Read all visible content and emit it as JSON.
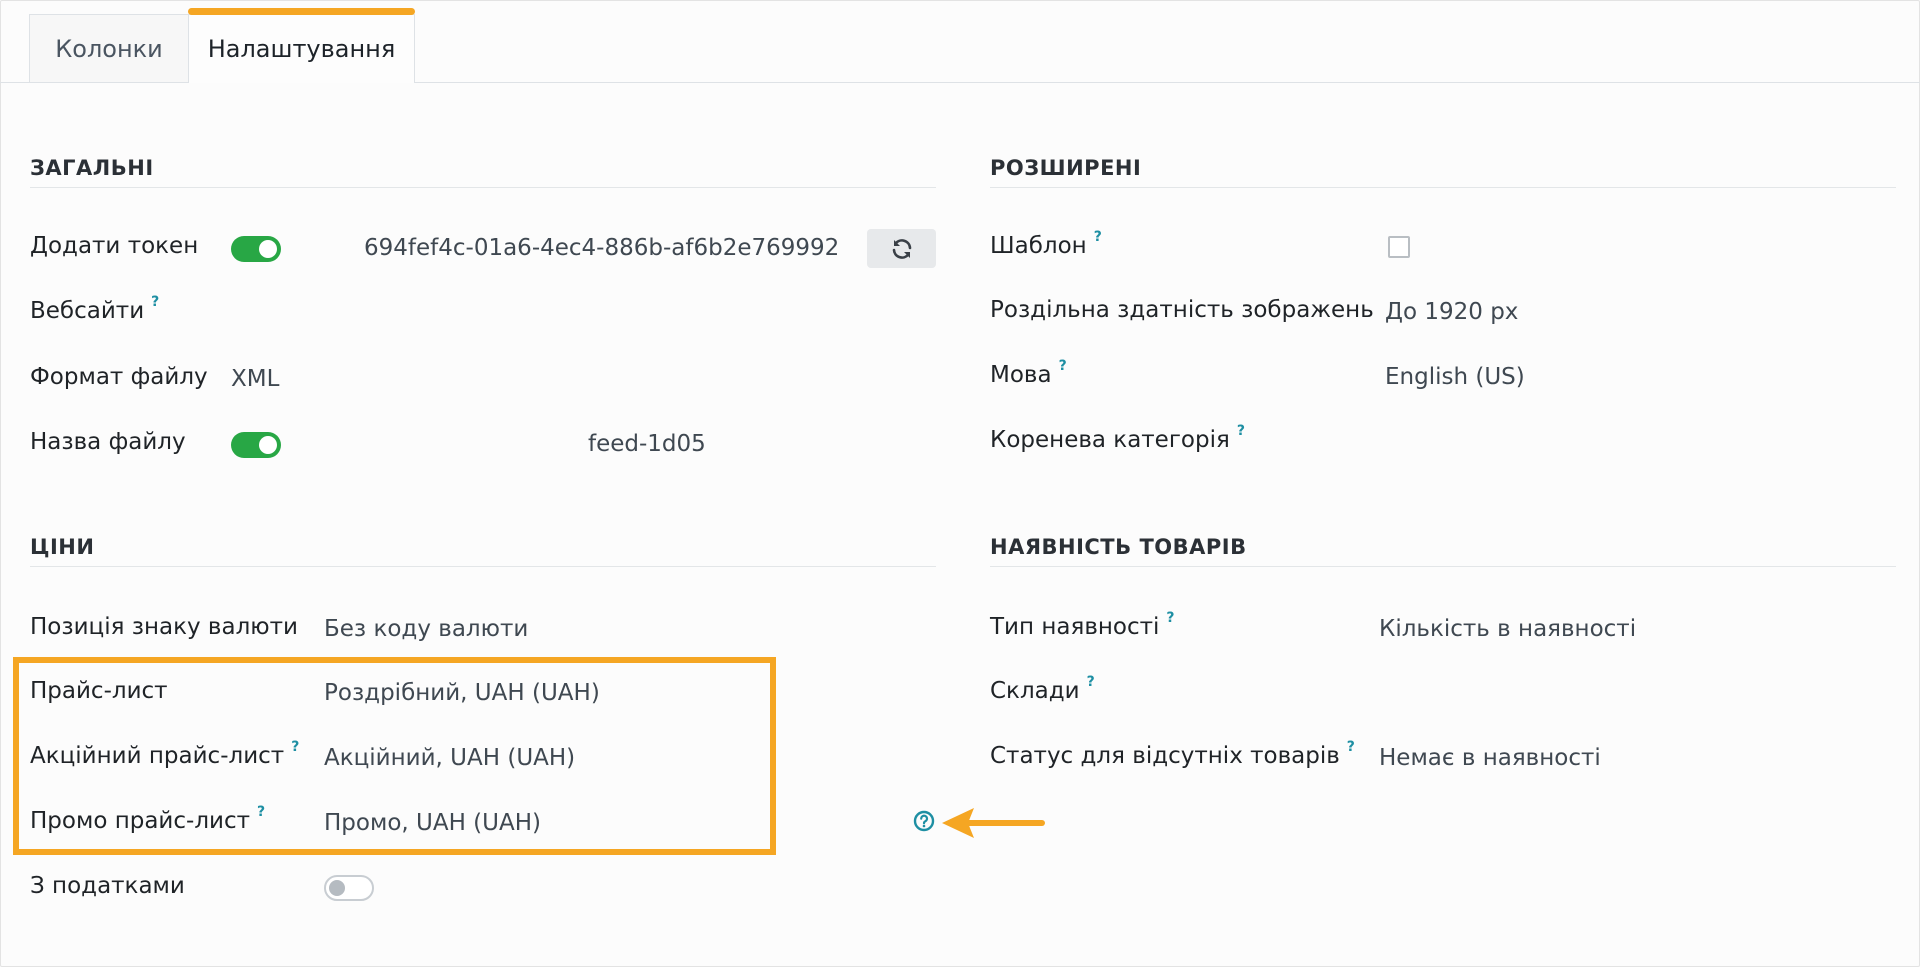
{
  "tabs": [
    {
      "label": "Колонки",
      "active": false
    },
    {
      "label": "Налаштування",
      "active": true
    }
  ],
  "general": {
    "title": "ЗАГАЛЬНІ",
    "add_token_label": "Додати токен",
    "add_token_enabled": true,
    "token_value": "694fef4c-01a6-4ec4-886b-af6b2e769992",
    "websites_label": "Вебсайти",
    "file_format_label": "Формат файлу",
    "file_format_value": "XML",
    "file_name_label": "Назва файлу",
    "file_name_enabled": true,
    "file_name_value": "feed-1d05"
  },
  "prices": {
    "title": "ЦІНИ",
    "currency_position_label": "Позиція знаку валюти",
    "currency_position_value": "Без коду валюти",
    "pricelist_label": "Прайс-лист",
    "pricelist_value": "Роздрібний, UAH (UAH)",
    "sale_pricelist_label": "Акційний прайс-лист",
    "sale_pricelist_value": "Акційний, UAH (UAH)",
    "promo_pricelist_label": "Промо прайс-лист",
    "promo_pricelist_value": "Промо, UAH (UAH)",
    "with_taxes_label": "З податками",
    "with_taxes_enabled": false
  },
  "advanced": {
    "title": "РОЗШИРЕНІ",
    "template_label": "Шаблон",
    "template_checked": false,
    "image_resolution_label": "Роздільна здатність зображень",
    "image_resolution_value": "До 1920 px",
    "language_label": "Мова",
    "language_value": "English (US)",
    "root_category_label": "Коренева категорія"
  },
  "availability": {
    "title": "НАЯВНІСТЬ ТОВАРІВ",
    "type_label": "Тип наявності",
    "type_value": "Кількість в наявності",
    "warehouses_label": "Склади",
    "missing_status_label": "Статус для відсутніх товарів",
    "missing_status_value": "Немає в наявності"
  },
  "help_mark": "?",
  "colors": {
    "accent": "#f5a623",
    "toggle_on": "#28a745",
    "help": "#1e8fa3"
  },
  "icons": {
    "refresh": "refresh-icon",
    "help": "question-circle-icon",
    "arrow": "arrow-left-icon"
  }
}
